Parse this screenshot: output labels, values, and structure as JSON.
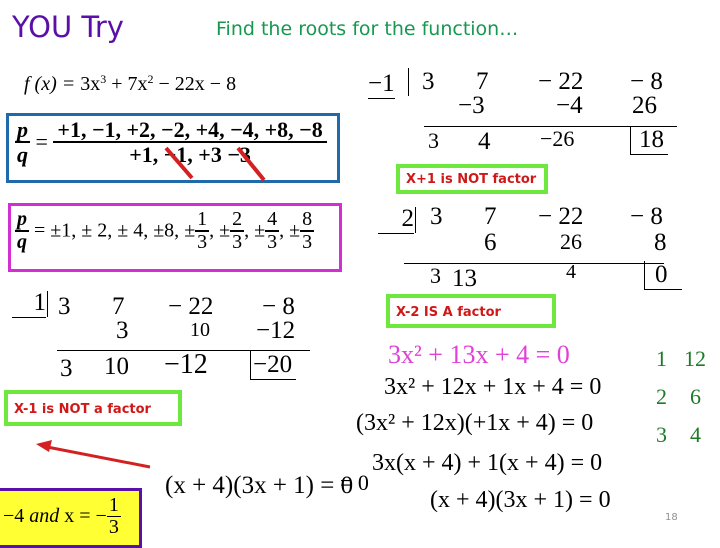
{
  "header": {
    "title": "YOU Try",
    "subtitle": "Find the roots for the function…"
  },
  "function": {
    "lhs": "f (x) = ",
    "terms": [
      "3x",
      "3",
      " + 7x",
      "2",
      " − 22x − 8"
    ]
  },
  "pq_blue": {
    "lhs_num": "p",
    "lhs_den": "q",
    "equals": "=",
    "numerator": "+1, −1, +2, −2, +4, −4, +8, −8",
    "denominator": "+1, −1, +3 −3",
    "crossed_out": [
      "−1",
      "−3"
    ]
  },
  "pq_magenta": {
    "lhs_num": "p",
    "lhs_den": "q",
    "list_prefix": "= ±1, ± 2, ± 4, ±8,",
    "fractions": [
      {
        "sign": "±",
        "num": "1",
        "den": "3"
      },
      {
        "sign": "±",
        "num": "2",
        "den": "3"
      },
      {
        "sign": "±",
        "num": "4",
        "den": "3"
      },
      {
        "sign": "±",
        "num": "8",
        "den": "3"
      }
    ]
  },
  "synthetic_divisions": [
    {
      "divisor": "−1",
      "coefficients": [
        "3",
        "7",
        "− 22",
        "− 8"
      ],
      "products": [
        "",
        "−3",
        "−4",
        "26"
      ],
      "results": [
        "3",
        "4",
        "−26",
        "18"
      ],
      "remainder": "18",
      "label": "X+1 is NOT factor"
    },
    {
      "divisor": "2",
      "coefficients": [
        "3",
        "7",
        "− 22",
        "− 8"
      ],
      "products": [
        "",
        "6",
        "26",
        "8"
      ],
      "results": [
        "3",
        "13",
        "4",
        "0"
      ],
      "remainder": "0",
      "label": "X-2 IS A factor"
    },
    {
      "divisor": "1",
      "coefficients": [
        "3",
        "7",
        "− 22",
        "− 8"
      ],
      "products": [
        "",
        "3",
        "10",
        "−12"
      ],
      "results": [
        "3",
        "10",
        "−12",
        "−20"
      ],
      "remainder": "−20",
      "label": "X-1 is NOT a factor"
    }
  ],
  "factoring": {
    "quadratic": "3x² + 13x + 4 = 0",
    "steps": [
      "3x² + 12x + 1x + 4 = 0",
      "(3x² + 12x)(+1x + 4) = 0",
      "3x(x + 4) + 1(x + 4) = 0",
      "(x + 4)(3x + 1) = 0"
    ],
    "factor_pairs": [
      [
        "1",
        "12"
      ],
      [
        "2",
        "6"
      ],
      [
        "3",
        "4"
      ]
    ],
    "left_result": "(x + 4)(3x + 1) = 0",
    "stray_equals": "= 0"
  },
  "answer": {
    "text_prefix": "−4 ",
    "and": "and",
    "text_mid": " x = −",
    "frac_num": "1",
    "frac_den": "3"
  },
  "colors": {
    "title": "#5a10a8",
    "subtitle": "#179850",
    "blue_box": "#1f6aab",
    "magenta_box": "#d12fd1",
    "label_border": "#6ee83e",
    "label_text": "#d01818",
    "arrow": "#d42020",
    "answer_bg": "#ffff33"
  },
  "page_number": "18"
}
